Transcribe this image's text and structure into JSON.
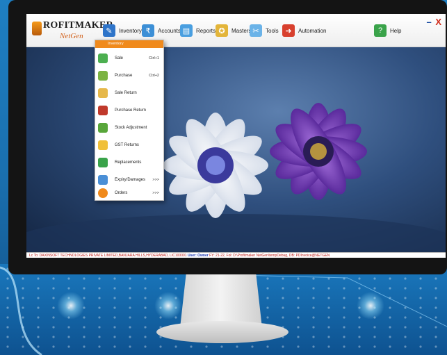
{
  "app": {
    "logo_title": "ROFITMAKER",
    "logo_sub": "NetGen"
  },
  "menubar": {
    "items": [
      {
        "label": "Inventory",
        "icon": "inventory-icon"
      },
      {
        "label": "Accounts",
        "icon": "accounts-icon"
      },
      {
        "label": "Reports",
        "icon": "reports-icon"
      },
      {
        "label": "Masters",
        "icon": "masters-icon"
      },
      {
        "label": "Tools",
        "icon": "tools-icon"
      },
      {
        "label": "Automation",
        "icon": "automation-icon"
      },
      {
        "label": "Help",
        "icon": "help-icon"
      }
    ],
    "minimize": "–",
    "close": "X"
  },
  "dropdown": {
    "header": "Inventory",
    "items": [
      {
        "label": "Sale",
        "shortcut": "Ctrl+1",
        "icon": "sale-icon"
      },
      {
        "label": "Purchase",
        "shortcut": "Ctrl+2",
        "icon": "purchase-icon"
      },
      {
        "label": "Sale Return",
        "shortcut": "",
        "icon": "sale-return-icon"
      },
      {
        "label": "Purchase Return",
        "shortcut": "",
        "icon": "purchase-return-icon"
      },
      {
        "label": "Stock Adjustment",
        "shortcut": "",
        "icon": "stock-adjustment-icon"
      },
      {
        "label": "GST Returns",
        "shortcut": "",
        "icon": "gst-returns-icon"
      },
      {
        "label": "Replacements",
        "shortcut": "",
        "icon": "replacements-icon"
      },
      {
        "label": "Expiry/Damages",
        "shortcut": ">>>",
        "icon": "expiry-damages-icon"
      },
      {
        "label": "Orders",
        "shortcut": ">>>",
        "icon": "orders-icon"
      }
    ]
  },
  "statusbar": {
    "license": "Lc To: DAXINSOFT TECHNOLOGIES PRIVATE LIMITED,BANJARA HILLS,HYDERABAD, LIC100001",
    "user": "User: Owner",
    "info": "FY: 21-22, Fol: D:\\Profitmaker NetGen\\tempDebug, DB: PDInvoice@NETGEN"
  },
  "colors": {
    "accent": "#f08a1c",
    "brand_orange": "#d2601a",
    "status_red": "#c0201a",
    "status_blue": "#1a36b0"
  }
}
